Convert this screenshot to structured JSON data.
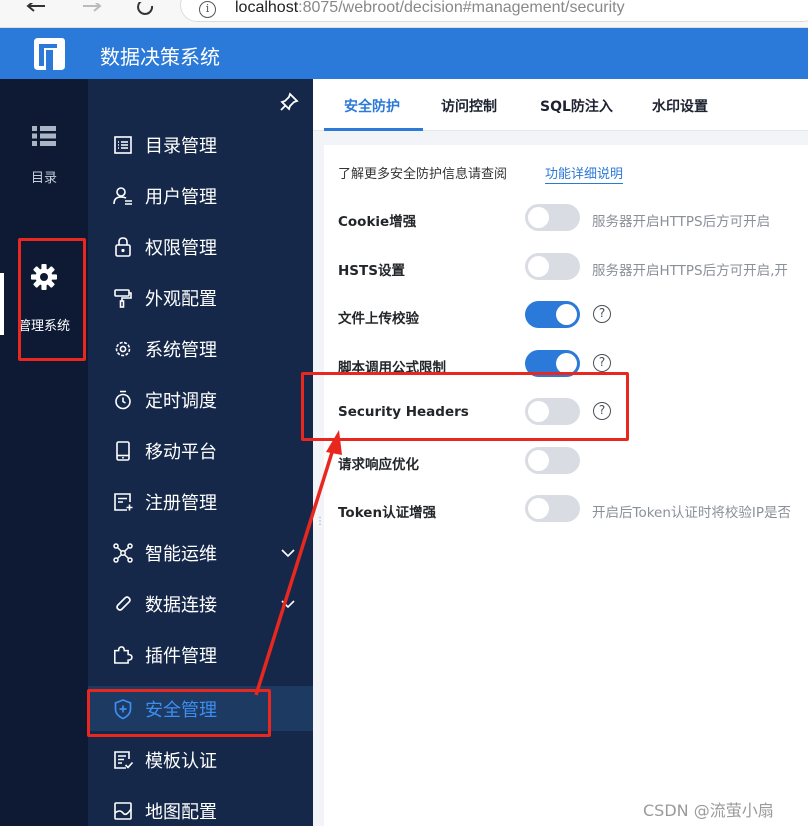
{
  "browser": {
    "url_host": "localhost",
    "url_path": ":8075/webroot/decision#management/security",
    "icons": [
      "back-arrow-icon",
      "forward-arrow-icon",
      "reload-icon",
      "info-icon"
    ]
  },
  "header": {
    "title": "数据决策系统",
    "brand_color": "#2b79d8"
  },
  "rail": {
    "items": [
      {
        "label": "目录",
        "icon": "list-icon"
      },
      {
        "label": "管理系统",
        "icon": "gear-icon",
        "active": true
      }
    ]
  },
  "sidebar": {
    "items": [
      {
        "label": "目录管理",
        "icon": "directory-icon"
      },
      {
        "label": "用户管理",
        "icon": "user-icon"
      },
      {
        "label": "权限管理",
        "icon": "lock-icon"
      },
      {
        "label": "外观配置",
        "icon": "paint-roller-icon"
      },
      {
        "label": "系统管理",
        "icon": "gear-icon"
      },
      {
        "label": "定时调度",
        "icon": "timer-icon"
      },
      {
        "label": "移动平台",
        "icon": "mobile-icon"
      },
      {
        "label": "注册管理",
        "icon": "register-icon"
      },
      {
        "label": "智能运维",
        "icon": "network-icon",
        "expandable": true
      },
      {
        "label": "数据连接",
        "icon": "link-icon",
        "expandable": true
      },
      {
        "label": "插件管理",
        "icon": "puzzle-icon"
      },
      {
        "label": "安全管理",
        "icon": "shield-icon",
        "active": true
      },
      {
        "label": "模板认证",
        "icon": "template-icon"
      },
      {
        "label": "地图配置",
        "icon": "map-icon"
      }
    ]
  },
  "tabs": [
    {
      "label": "安全防护",
      "active": true
    },
    {
      "label": "访问控制"
    },
    {
      "label": "SQL防注入"
    },
    {
      "label": "水印设置"
    }
  ],
  "panel": {
    "info_text": "了解更多安全防护信息请查阅",
    "info_link": "功能详细说明",
    "settings": [
      {
        "label": "Cookie增强",
        "enabled": false,
        "hint": "服务器开启HTTPS后方可开启"
      },
      {
        "label": "HSTS设置",
        "enabled": false,
        "hint": "服务器开启HTTPS后方可开启,开"
      },
      {
        "label": "文件上传校验",
        "enabled": true,
        "help": "?"
      },
      {
        "label": "脚本调用公式限制",
        "enabled": true,
        "help": "?"
      },
      {
        "label": "Security Headers",
        "enabled": false,
        "help": "?"
      },
      {
        "label": "请求响应优化",
        "enabled": false
      },
      {
        "label": "Token认证增强",
        "enabled": false,
        "hint": "开启后Token认证时将校验IP是否"
      }
    ]
  },
  "watermark": "CSDN @流萤小扇",
  "annotation_color": "#e8271f"
}
